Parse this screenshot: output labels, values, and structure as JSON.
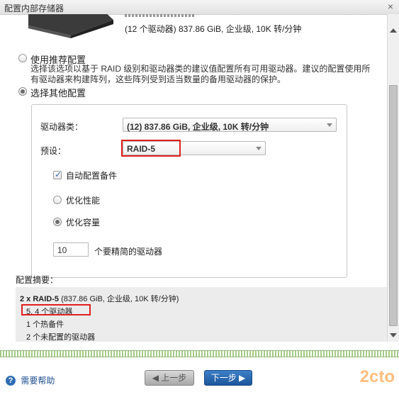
{
  "window": {
    "title": "配置内部存储器",
    "close_glyph": "×"
  },
  "drive": {
    "description": "(12 个驱动器) 837.86 GiB, 企业级, 10K 转/分钟"
  },
  "options": {
    "recommended": {
      "label": "使用推荐配置",
      "description": "选择该选项以基于 RAID 级别和驱动器类的建议值配置所有可用驱动器。建议的配置使用所有驱动器来构建阵列，这些阵列受到适当数量的备用驱动器的保护。"
    },
    "other": {
      "label": "选择其他配置"
    }
  },
  "config": {
    "drive_class_label": "驱动器类：",
    "drive_class_value": "(12) 837.86 GiB, 企业级, 10K 转/分钟",
    "preset_label": "预设：",
    "preset_value": "RAID-5",
    "auto_spare_label": "自动配置备件",
    "optimize_performance_label": "优化性能",
    "optimize_capacity_label": "优化容量",
    "drives_to_exclude_value": "10",
    "drives_to_exclude_label": "个要精简的驱动器"
  },
  "summary": {
    "heading": "配置摘要：",
    "line1": "2 x RAID-5 (837.86 GiB, 企业级, 10K 转/分钟)",
    "line2": "5, 4 个驱动器",
    "line3": "1 个热备件",
    "line4": "2 个未配置的驱动器"
  },
  "footer": {
    "help_icon_glyph": "?",
    "help_label": "需要帮助",
    "prev_label": "◀ 上一步",
    "next_label": "下一步 ▶"
  },
  "watermark": "2cto",
  "colors": {
    "accent": "#1c5599",
    "highlight": "#e02020"
  }
}
